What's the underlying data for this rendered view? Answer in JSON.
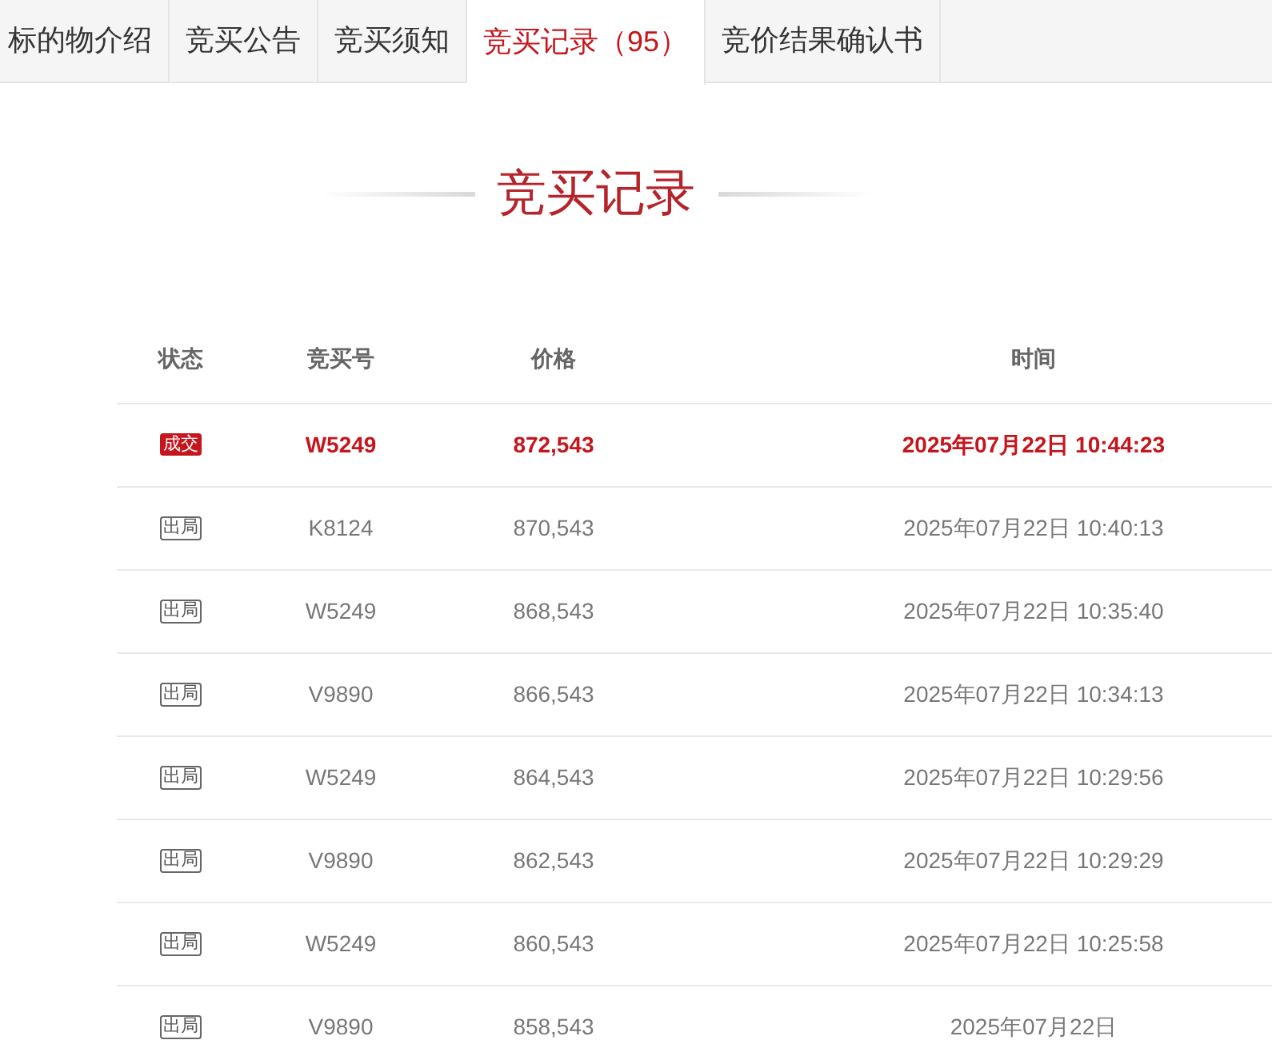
{
  "tabs": [
    {
      "label": "标的物介绍",
      "selected": false
    },
    {
      "label": "竞买公告",
      "selected": false
    },
    {
      "label": "竞买须知",
      "selected": false
    },
    {
      "label": "竞买记录（95）",
      "selected": true
    },
    {
      "label": "竞价结果确认书",
      "selected": false
    }
  ],
  "section_title": "竞买记录",
  "table": {
    "columns": [
      "状态",
      "竞买号",
      "价格",
      "时间"
    ],
    "rows": [
      {
        "status": "成交",
        "kind": "won",
        "bidder": "W5249",
        "price": "872,543",
        "time": "2025年07月22日 10:44:23"
      },
      {
        "status": "出局",
        "kind": "out",
        "bidder": "K8124",
        "price": "870,543",
        "time": "2025年07月22日 10:40:13"
      },
      {
        "status": "出局",
        "kind": "out",
        "bidder": "W5249",
        "price": "868,543",
        "time": "2025年07月22日 10:35:40"
      },
      {
        "status": "出局",
        "kind": "out",
        "bidder": "V9890",
        "price": "866,543",
        "time": "2025年07月22日 10:34:13"
      },
      {
        "status": "出局",
        "kind": "out",
        "bidder": "W5249",
        "price": "864,543",
        "time": "2025年07月22日 10:29:56"
      },
      {
        "status": "出局",
        "kind": "out",
        "bidder": "V9890",
        "price": "862,543",
        "time": "2025年07月22日 10:29:29"
      },
      {
        "status": "出局",
        "kind": "out",
        "bidder": "W5249",
        "price": "860,543",
        "time": "2025年07月22日 10:25:58"
      },
      {
        "status": "出局",
        "kind": "out",
        "bidder": "V9890",
        "price": "858,543",
        "time": "2025年07月22日"
      }
    ]
  }
}
